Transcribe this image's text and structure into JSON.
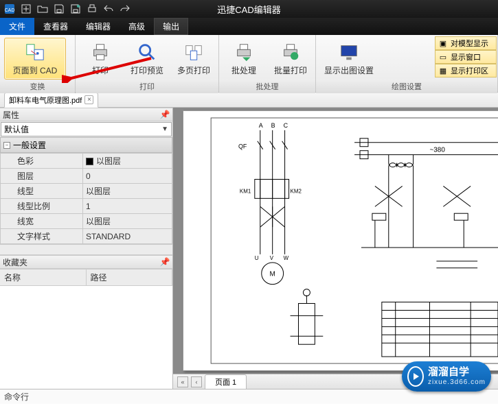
{
  "app_title": "迅捷CAD编辑器",
  "menu": {
    "file": "文件",
    "viewer": "查看器",
    "editor": "编辑器",
    "advanced": "高级",
    "output": "输出"
  },
  "ribbon": {
    "page_to_cad": "页面到 CAD",
    "print": "打印",
    "print_preview": "打印预览",
    "multi_print": "多页打印",
    "batch": "批处理",
    "batch_print": "批量打印",
    "plot_settings": "显示出图设置",
    "group_convert": "变换",
    "group_print": "打印",
    "group_batch": "批处理",
    "group_draw": "绘图设置",
    "opt_model": "对模型显示",
    "opt_window": "显示窗口",
    "opt_printzone": "显示打印区"
  },
  "doc_tab": "卸料车电气原理图.pdf",
  "panels": {
    "props": "属性",
    "default": "默认值",
    "general": "一般设置",
    "favorites": "收藏夹",
    "rows": [
      {
        "k": "色彩",
        "v": "以图层",
        "swatch": true
      },
      {
        "k": "图层",
        "v": "0"
      },
      {
        "k": "线型",
        "v": "以图层"
      },
      {
        "k": "线型比例",
        "v": "1"
      },
      {
        "k": "线宽",
        "v": "以图层"
      },
      {
        "k": "文字样式",
        "v": "STANDARD"
      }
    ],
    "fav_cols": {
      "name": "名称",
      "path": "路径"
    }
  },
  "page_tab": "页面 1",
  "cmd_label": "命令行",
  "badge": {
    "t1": "溜溜自学",
    "t2": "zixue.3d66.com"
  },
  "chart_data": {
    "type": "schematic",
    "title": "卸料车电气原理图",
    "voltage": "~380",
    "phases": [
      "A",
      "B",
      "C"
    ],
    "components": [
      "QF",
      "KM1",
      "KM2",
      "M",
      "U",
      "V",
      "W"
    ]
  }
}
